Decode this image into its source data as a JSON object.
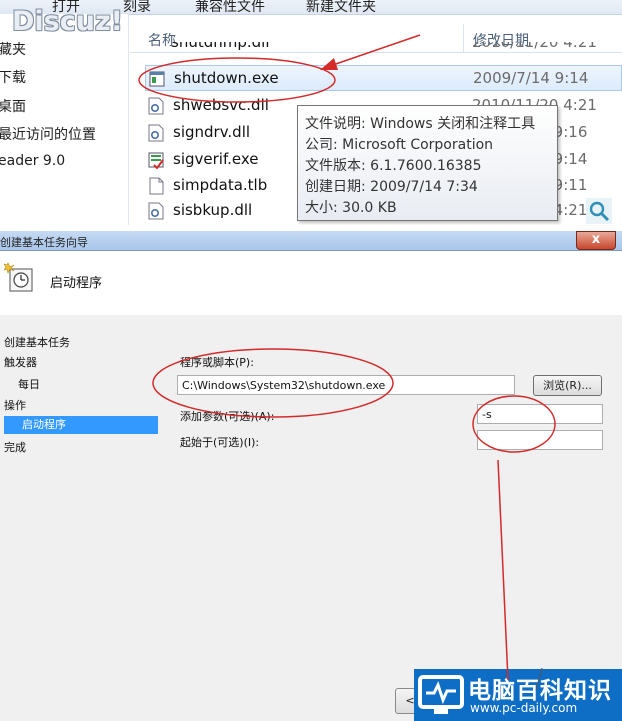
{
  "explorer": {
    "toolbar": [
      "打开",
      "刻录",
      "新建文件夹"
    ],
    "toolbar_partial": "兼容性文件",
    "logo": "Discuz!",
    "nav_items": [
      "藏夹",
      "下载",
      "桌面",
      "最近访问的位置",
      "eader 9.0"
    ],
    "columns": {
      "name": "名称",
      "modified": "修改日期"
    },
    "files": [
      {
        "name": "shutdown.exe",
        "date": "2009/7/14 9:14",
        "icon": "exe-window-icon",
        "selected": true
      },
      {
        "name": "shwebsvc.dll",
        "date": "2010/11/20 4:21",
        "icon": "dll-gear-icon"
      },
      {
        "name": "signdrv.dll",
        "date": "2009/7/14 9:16",
        "icon": "dll-gear-icon"
      },
      {
        "name": "sigverif.exe",
        "date": "2009/7/14 9:14",
        "icon": "sigverif-check-icon"
      },
      {
        "name": "simpdata.tlb",
        "date": "2009/7/14 9:11",
        "icon": "blank-file-icon"
      },
      {
        "name": "sisbkup.dll",
        "date": "2009/7/14 4:21",
        "icon": "dll-gear-icon"
      }
    ],
    "tooltip": [
      "文件说明: Windows 关闭和注释工具",
      "公司: Microsoft Corporation",
      "文件版本: 6.1.7600.16385",
      "创建日期: 2009/7/14 7:34",
      "大小: 30.0 KB"
    ]
  },
  "wizard": {
    "title": "创建基本任务向导",
    "close_label": "x",
    "header": "启动程序",
    "steps": [
      "创建基本任务",
      "触发器",
      "每日",
      "操作",
      "启动程序",
      "完成"
    ],
    "active_step": "启动程序",
    "program_label": "程序或脚本(P):",
    "program_value": "C:\\Windows\\System32\\shutdown.exe",
    "browse_label": "浏览(R)...",
    "args_label": "添加参数(可选)(A):",
    "args_value": "-s",
    "start_label": "起始于(可选)(I):",
    "start_value": "",
    "back_label": "<"
  },
  "watermark": {
    "title": "电脑百科知识",
    "url": "www.pc-daily.com"
  },
  "colors": {
    "annotation": "#d42a2a",
    "selection": "#dcebfc",
    "active_step": "#3399ff",
    "watermark_bg": "#0e6ec6"
  }
}
